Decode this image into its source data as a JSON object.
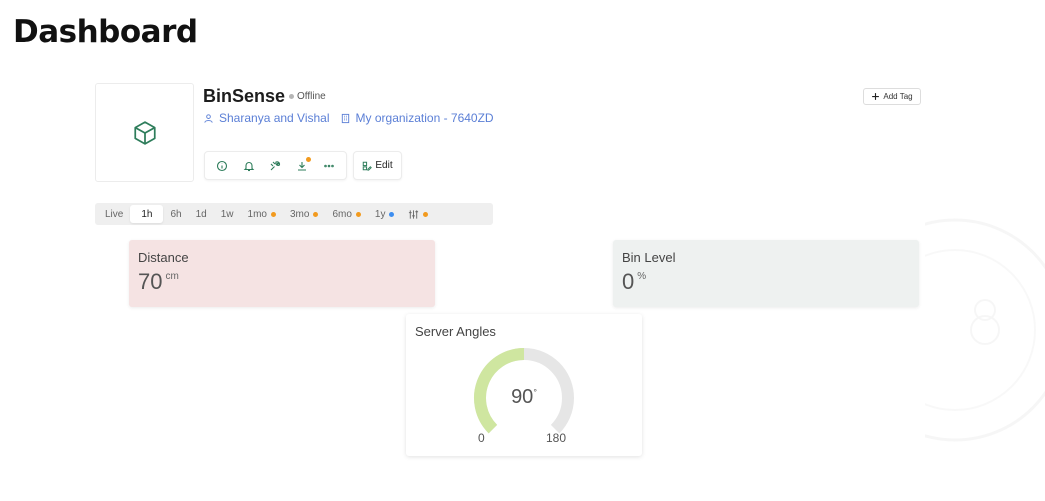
{
  "page": {
    "title": "Dashboard"
  },
  "device": {
    "name": "BinSense",
    "status": "Offline",
    "owner": "Sharanya and Vishal",
    "organization": "My organization - 7640ZD",
    "edit_label": "Edit",
    "add_tag_label": "Add Tag",
    "toolbar_icons": [
      "info-icon",
      "bell-icon",
      "wrench-icon",
      "download-icon",
      "more-icon"
    ],
    "icon_color": "#2e7d5b"
  },
  "time_ranges": [
    {
      "label": "Live"
    },
    {
      "label": "1h",
      "active": true
    },
    {
      "label": "6h"
    },
    {
      "label": "1d"
    },
    {
      "label": "1w"
    },
    {
      "label": "1mo",
      "dot": "#f29a1e"
    },
    {
      "label": "3mo",
      "dot": "#f29a1e"
    },
    {
      "label": "6mo",
      "dot": "#f29a1e"
    },
    {
      "label": "1y",
      "dot": "#3d8ef0"
    },
    {
      "label": "",
      "icon": "sliders-icon",
      "dot": "#f29a1e"
    }
  ],
  "widgets": {
    "distance": {
      "title": "Distance",
      "value": "70",
      "unit": "cm",
      "bg": "#f5e3e3"
    },
    "bin_level": {
      "title": "Bin Level",
      "value": "0",
      "unit": "%",
      "bg": "#eef1f0"
    },
    "servo": {
      "title": "Server Angles",
      "value": 90,
      "unit": "°",
      "min": 0,
      "max": 180,
      "fill_color": "#cfe6a0",
      "track_color": "#e6e6e6"
    }
  }
}
